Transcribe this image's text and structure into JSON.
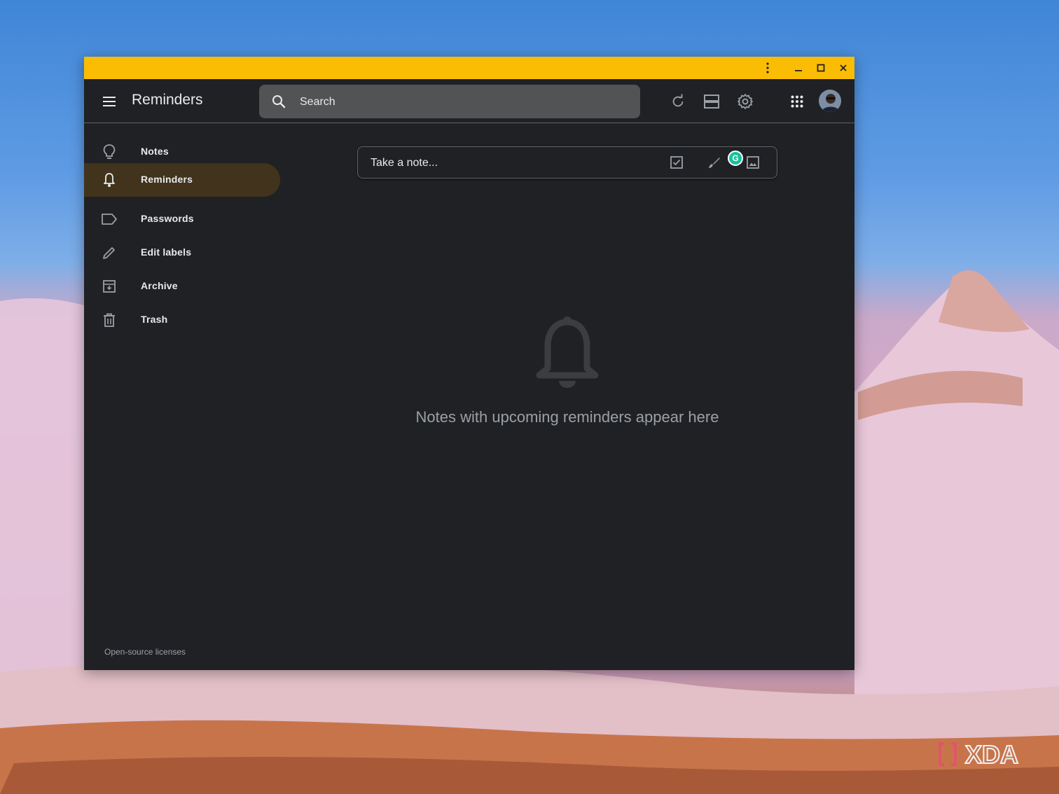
{
  "header": {
    "title": "Reminders",
    "search_placeholder": "Search"
  },
  "sidebar": {
    "items": [
      {
        "label": "Notes",
        "icon": "lightbulb-icon",
        "active": false
      },
      {
        "label": "Reminders",
        "icon": "bell-icon",
        "active": true
      },
      {
        "label": "Passwords",
        "icon": "label-icon",
        "active": false
      },
      {
        "label": "Edit labels",
        "icon": "pencil-icon",
        "active": false
      },
      {
        "label": "Archive",
        "icon": "archive-icon",
        "active": false
      },
      {
        "label": "Trash",
        "icon": "trash-icon",
        "active": false
      }
    ],
    "footer_link": "Open-source licenses"
  },
  "composer": {
    "placeholder": "Take a note..."
  },
  "empty_state": {
    "message": "Notes with upcoming reminders appear here"
  },
  "watermark": "XDA",
  "colors": {
    "titlebar": "#fbbc04",
    "background": "#202124",
    "active_item": "#41331c",
    "search_bg": "#525355",
    "text": "#e8eaed",
    "muted_text": "#9aa0a6"
  }
}
